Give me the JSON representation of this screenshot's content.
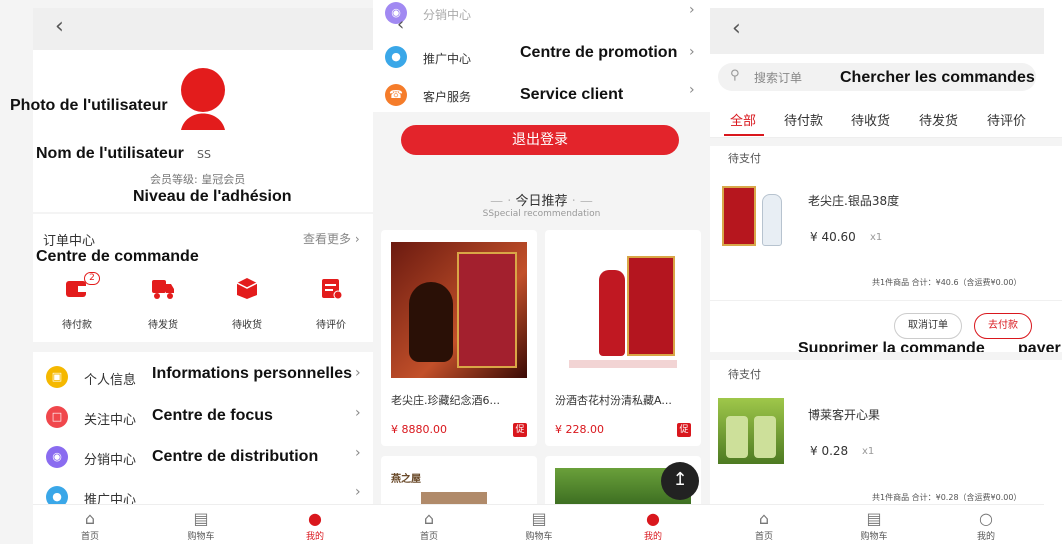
{
  "profile": {
    "annotations": {
      "photo": "Photo de l'utilisateur",
      "name": "Nom de l'utilisateur",
      "level": "Niveau de l'adhésion",
      "orders": "Centre de commande",
      "personal": "Informations personnelles",
      "focus": "Centre de focus",
      "distribution": "Centre de distribution"
    },
    "username": "SS",
    "member_level": "会员等级: 皇冠会员",
    "order_center": {
      "title": "订单中心",
      "more": "查看更多",
      "items": [
        {
          "label": "待付款",
          "icon": "wallet-icon",
          "badge": "2"
        },
        {
          "label": "待发货",
          "icon": "truck-icon",
          "badge": ""
        },
        {
          "label": "待收货",
          "icon": "box-icon",
          "badge": ""
        },
        {
          "label": "待评价",
          "icon": "calendar-check-icon",
          "badge": ""
        }
      ]
    },
    "menu": [
      {
        "label": "个人信息",
        "icon": "id-card-icon",
        "color": "#f5b800"
      },
      {
        "label": "关注中心",
        "icon": "bookmark-icon",
        "color": "#f0474c"
      },
      {
        "label": "分销中心",
        "icon": "share-icon",
        "color": "#8a6cf0"
      },
      {
        "label": "推广中心",
        "icon": "promo-icon",
        "color": "#3aa7e8"
      }
    ]
  },
  "promo": {
    "annotations": {
      "promotion": "Centre de promotion",
      "service": "Service client"
    },
    "menu_top": "分销中心",
    "menu": [
      {
        "label": "推广中心",
        "icon": "promo-icon",
        "color": "#3aa7e8"
      },
      {
        "label": "客户服务",
        "icon": "phone-icon",
        "color": "#f57c2a"
      }
    ],
    "logout": "退出登录",
    "recommend_title": "今日推荐",
    "recommend_sub": "SSpecial recommendation",
    "products": [
      {
        "name": "老尖庄.珍藏纪念酒6...",
        "price": "¥ 8880.00",
        "tag": "促"
      },
      {
        "name": "汾酒杏花村汾清私藏A...",
        "price": "¥ 228.00",
        "tag": "促"
      }
    ],
    "product3_label": "燕之屋"
  },
  "orders": {
    "annotations": {
      "search": "Chercher les commandes",
      "delete": "Supprimer la commande",
      "pay": "payer"
    },
    "search_placeholder": "搜索订单",
    "tabs": [
      "全部",
      "待付款",
      "待收货",
      "待发货",
      "待评价"
    ],
    "list": [
      {
        "status": "待支付",
        "name": "老尖庄.银品38度",
        "price": "¥ 40.60",
        "qty": "x1",
        "summary": "共1件商品 合计：¥40.6（含运费¥0.00）",
        "cancel": "取消订单",
        "pay": "去付款"
      },
      {
        "status": "待支付",
        "name": "博莱客开心果",
        "price": "¥ 0.28",
        "qty": "x1",
        "summary": "共1件商品 合计：¥0.28（含运费¥0.00）"
      }
    ]
  },
  "tabbar": [
    "首页",
    "购物车",
    "我的"
  ],
  "colors": {
    "accent": "#d9171d",
    "button": "#e3242b"
  }
}
